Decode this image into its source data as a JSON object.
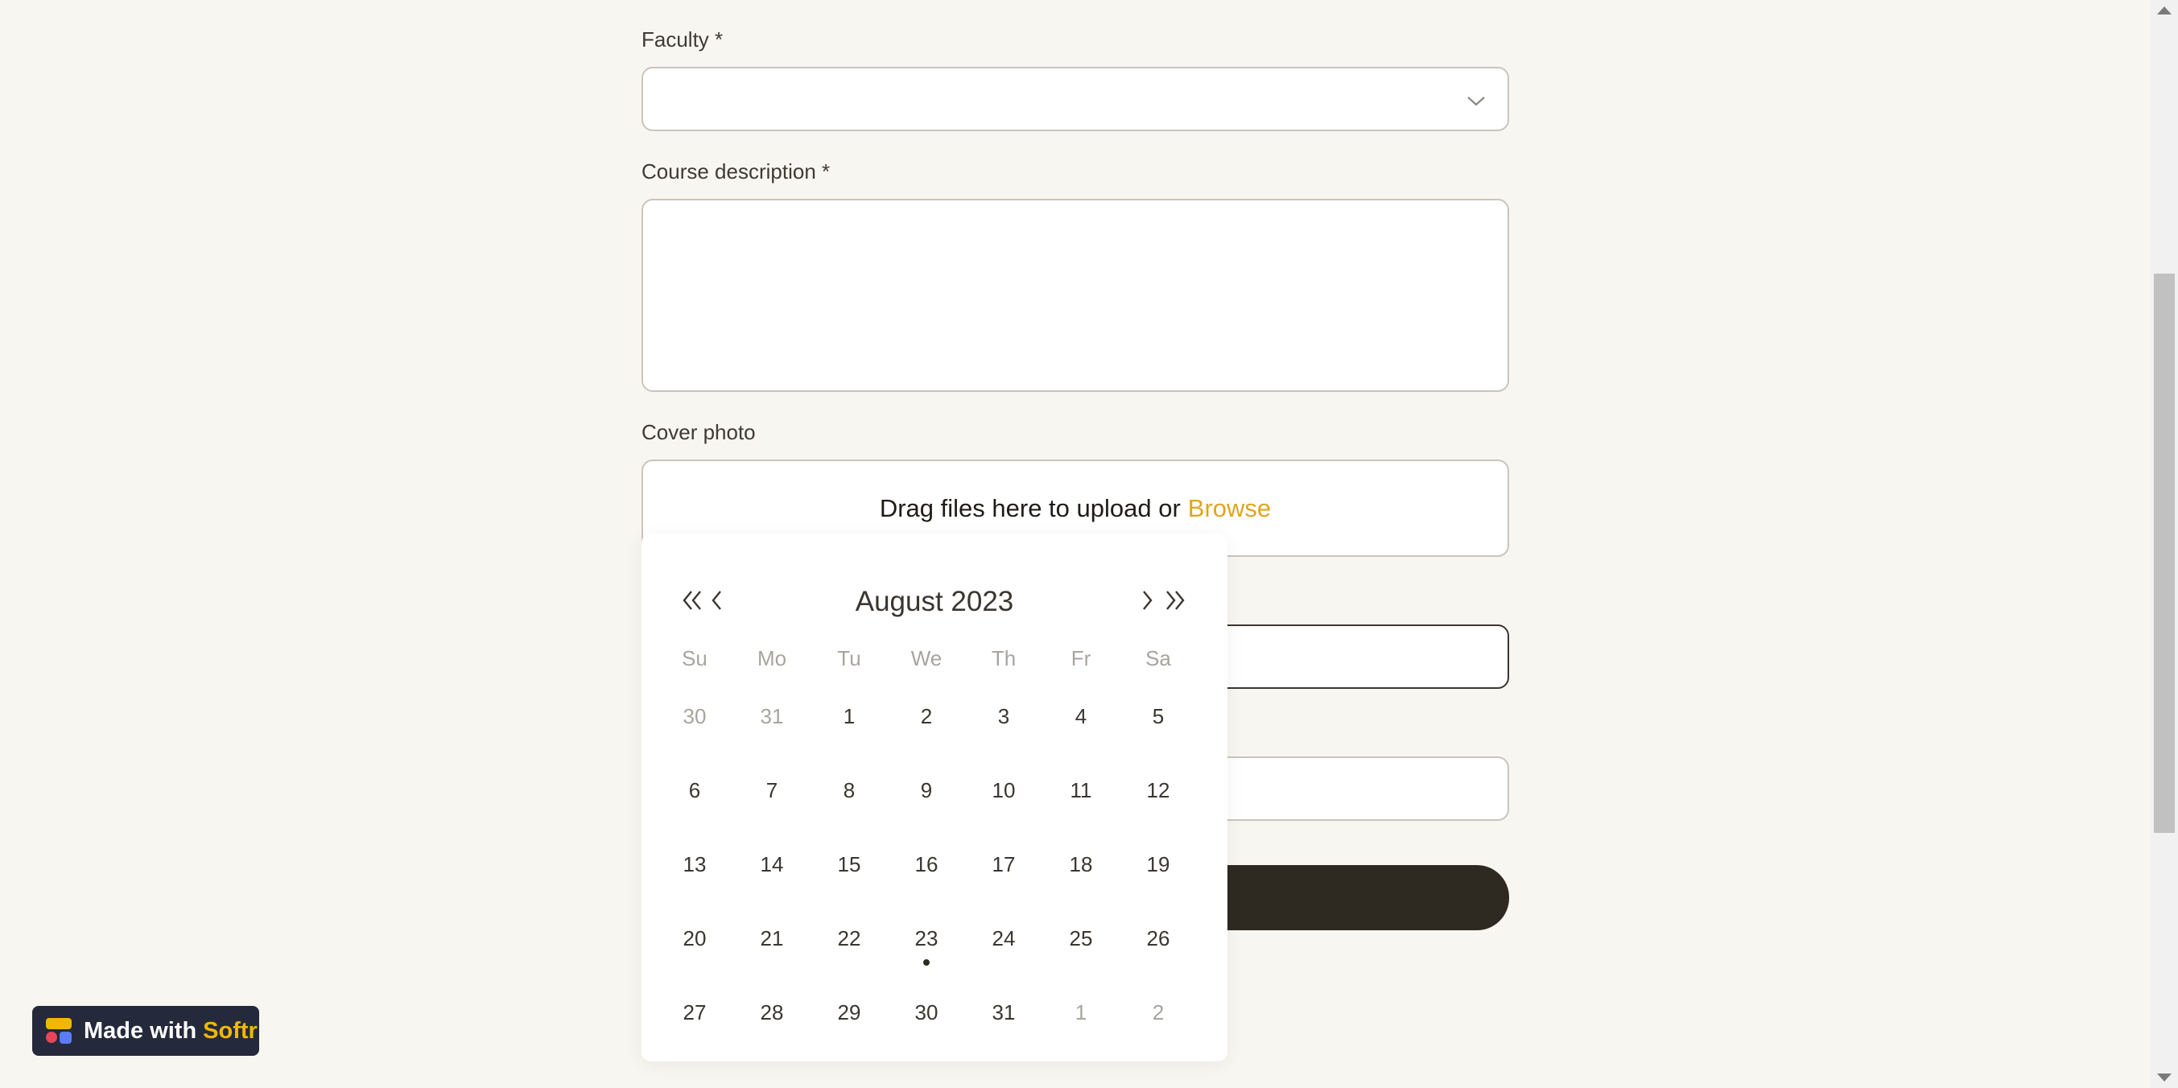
{
  "form": {
    "faculty_label": "Faculty *",
    "description_label": "Course description *",
    "cover_label": "Cover photo",
    "upload_text": "Drag files here to upload or",
    "upload_browse": "Browse"
  },
  "calendar": {
    "title": "August 2023",
    "weekdays": [
      "Su",
      "Mo",
      "Tu",
      "We",
      "Th",
      "Fr",
      "Sa"
    ],
    "weeks": [
      [
        "30",
        "31",
        "1",
        "2",
        "3",
        "4",
        "5"
      ],
      [
        "6",
        "7",
        "8",
        "9",
        "10",
        "11",
        "12"
      ],
      [
        "13",
        "14",
        "15",
        "16",
        "17",
        "18",
        "19"
      ],
      [
        "20",
        "21",
        "22",
        "23",
        "24",
        "25",
        "26"
      ],
      [
        "27",
        "28",
        "29",
        "30",
        "31",
        "1",
        "2"
      ]
    ],
    "muted": [
      [
        0,
        0
      ],
      [
        0,
        1
      ],
      [
        4,
        5
      ],
      [
        4,
        6
      ]
    ],
    "today": [
      3,
      3
    ]
  },
  "badge": {
    "prefix": "Made with",
    "brand": "Softr"
  },
  "colors": {
    "accent": "#e0a51f",
    "background": "#f8f6f0",
    "dark": "#2e2a22"
  }
}
